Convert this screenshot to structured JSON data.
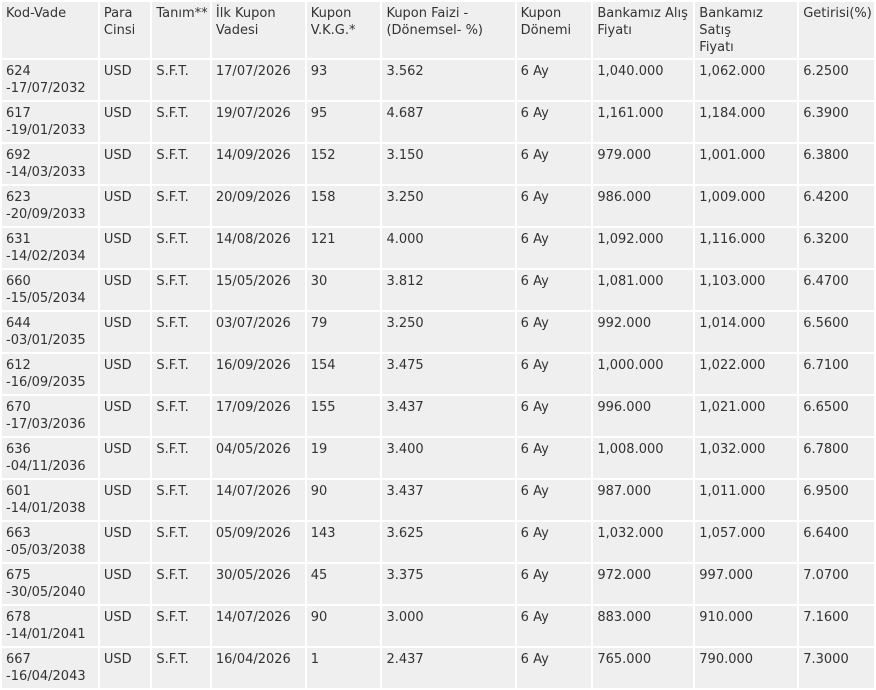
{
  "columns": [
    {
      "line1": "Kod-Vade",
      "line2": ""
    },
    {
      "line1": "Para",
      "line2": "Cinsi"
    },
    {
      "line1": "Tanım**",
      "line2": ""
    },
    {
      "line1": "İlk Kupon",
      "line2": "Vadesi"
    },
    {
      "line1": "Kupon",
      "line2": "V.K.G.*"
    },
    {
      "line1": "Kupon Faizi -",
      "line2": "(Dönemsel- %)"
    },
    {
      "line1": "Kupon",
      "line2": "Dönemi"
    },
    {
      "line1": "Bankamız Alış",
      "line2": "Fiyatı"
    },
    {
      "line1": "Bankamız Satış",
      "line2": "Fiyatı"
    },
    {
      "line1": "Getirisi(%)",
      "line2": ""
    }
  ],
  "rows": [
    {
      "code": "624",
      "maturity": "-17/07/2032",
      "currency": "USD",
      "type": "S.F.T.",
      "first_coupon": "17/07/2026",
      "vkg": "93",
      "coupon_rate": "3.562",
      "period": "6 Ay",
      "buy": "1,040.000",
      "sell": "1,062.000",
      "yield": "6.2500"
    },
    {
      "code": "617",
      "maturity": "-19/01/2033",
      "currency": "USD",
      "type": "S.F.T.",
      "first_coupon": "19/07/2026",
      "vkg": "95",
      "coupon_rate": "4.687",
      "period": "6 Ay",
      "buy": "1,161.000",
      "sell": "1,184.000",
      "yield": "6.3900"
    },
    {
      "code": "692",
      "maturity": "-14/03/2033",
      "currency": "USD",
      "type": "S.F.T.",
      "first_coupon": "14/09/2026",
      "vkg": "152",
      "coupon_rate": "3.150",
      "period": "6 Ay",
      "buy": "979.000",
      "sell": "1,001.000",
      "yield": "6.3800"
    },
    {
      "code": "623",
      "maturity": "-20/09/2033",
      "currency": "USD",
      "type": "S.F.T.",
      "first_coupon": "20/09/2026",
      "vkg": "158",
      "coupon_rate": "3.250",
      "period": "6 Ay",
      "buy": "986.000",
      "sell": "1,009.000",
      "yield": "6.4200"
    },
    {
      "code": "631",
      "maturity": "-14/02/2034",
      "currency": "USD",
      "type": "S.F.T.",
      "first_coupon": "14/08/2026",
      "vkg": "121",
      "coupon_rate": "4.000",
      "period": "6 Ay",
      "buy": "1,092.000",
      "sell": "1,116.000",
      "yield": "6.3200"
    },
    {
      "code": "660",
      "maturity": "-15/05/2034",
      "currency": "USD",
      "type": "S.F.T.",
      "first_coupon": "15/05/2026",
      "vkg": "30",
      "coupon_rate": "3.812",
      "period": "6 Ay",
      "buy": "1,081.000",
      "sell": "1,103.000",
      "yield": "6.4700"
    },
    {
      "code": "644",
      "maturity": "-03/01/2035",
      "currency": "USD",
      "type": "S.F.T.",
      "first_coupon": "03/07/2026",
      "vkg": "79",
      "coupon_rate": "3.250",
      "period": "6 Ay",
      "buy": "992.000",
      "sell": "1,014.000",
      "yield": "6.5600"
    },
    {
      "code": "612",
      "maturity": "-16/09/2035",
      "currency": "USD",
      "type": "S.F.T.",
      "first_coupon": "16/09/2026",
      "vkg": "154",
      "coupon_rate": "3.475",
      "period": "6 Ay",
      "buy": "1,000.000",
      "sell": "1,022.000",
      "yield": "6.7100"
    },
    {
      "code": "670",
      "maturity": "-17/03/2036",
      "currency": "USD",
      "type": "S.F.T.",
      "first_coupon": "17/09/2026",
      "vkg": "155",
      "coupon_rate": "3.437",
      "period": "6 Ay",
      "buy": "996.000",
      "sell": "1,021.000",
      "yield": "6.6500"
    },
    {
      "code": "636",
      "maturity": "-04/11/2036",
      "currency": "USD",
      "type": "S.F.T.",
      "first_coupon": "04/05/2026",
      "vkg": "19",
      "coupon_rate": "3.400",
      "period": "6 Ay",
      "buy": "1,008.000",
      "sell": "1,032.000",
      "yield": "6.7800"
    },
    {
      "code": "601",
      "maturity": "-14/01/2038",
      "currency": "USD",
      "type": "S.F.T.",
      "first_coupon": "14/07/2026",
      "vkg": "90",
      "coupon_rate": "3.437",
      "period": "6 Ay",
      "buy": "987.000",
      "sell": "1,011.000",
      "yield": "6.9500"
    },
    {
      "code": "663",
      "maturity": "-05/03/2038",
      "currency": "USD",
      "type": "S.F.T.",
      "first_coupon": "05/09/2026",
      "vkg": "143",
      "coupon_rate": "3.625",
      "period": "6 Ay",
      "buy": "1,032.000",
      "sell": "1,057.000",
      "yield": "6.6400"
    },
    {
      "code": "675",
      "maturity": "-30/05/2040",
      "currency": "USD",
      "type": "S.F.T.",
      "first_coupon": "30/05/2026",
      "vkg": "45",
      "coupon_rate": "3.375",
      "period": "6 Ay",
      "buy": "972.000",
      "sell": "997.000",
      "yield": "7.0700"
    },
    {
      "code": "678",
      "maturity": "-14/01/2041",
      "currency": "USD",
      "type": "S.F.T.",
      "first_coupon": "14/07/2026",
      "vkg": "90",
      "coupon_rate": "3.000",
      "period": "6 Ay",
      "buy": "883.000",
      "sell": "910.000",
      "yield": "7.1600"
    },
    {
      "code": "667",
      "maturity": "-16/04/2043",
      "currency": "USD",
      "type": "S.F.T.",
      "first_coupon": "16/04/2026",
      "vkg": "1",
      "coupon_rate": "2.437",
      "period": "6 Ay",
      "buy": "765.000",
      "sell": "790.000",
      "yield": "7.3000"
    }
  ],
  "colors": {
    "cell_background": "#efefef",
    "gridline": "#ffffff",
    "text": "#333333"
  }
}
